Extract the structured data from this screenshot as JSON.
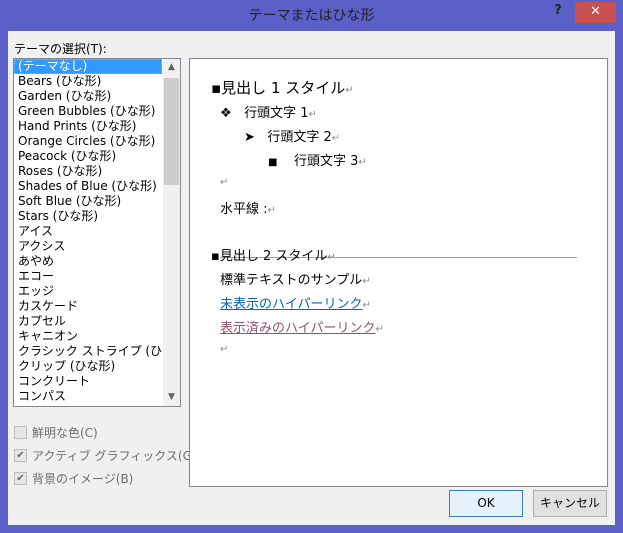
{
  "window": {
    "title": "テーマまたはひな形",
    "help": "?",
    "close": "✕"
  },
  "theme_label": "テーマの選択(T):",
  "themes": [
    "(テーマなし)",
    "Bears (ひな形)",
    "Garden (ひな形)",
    "Green Bubbles (ひな形)",
    "Hand Prints (ひな形)",
    "Orange Circles (ひな形)",
    "Peacock (ひな形)",
    "Roses (ひな形)",
    "Shades of Blue (ひな形)",
    "Soft Blue (ひな形)",
    "Stars (ひな形)",
    "アイス",
    "アクシス",
    "あやめ",
    "エコー",
    "エッジ",
    "カスケード",
    "カプセル",
    "キャニオン",
    "クラシック ストライプ (ひな形)",
    "クリップ (ひな形)",
    "コンクリート",
    "コンパス"
  ],
  "selected_theme": "(テーマなし)",
  "options": [
    {
      "label": "鮮明な色(C)",
      "checked": false
    },
    {
      "label": "アクティブ グラフィックス(G)",
      "checked": true
    },
    {
      "label": "背景のイメージ(B)",
      "checked": true
    }
  ],
  "preview": {
    "heading1": "見出し 1 スタイル",
    "bullet1": "行頭文字 1",
    "bullet2": "行頭文字 2",
    "bullet3": "行頭文字 3",
    "hr_label": "水平線 :",
    "heading2": "見出し 2 スタイル",
    "normal": "標準テキストのサンプル",
    "link": "未表示のハイパーリンク",
    "visited": "表示済みのハイパーリンク",
    "para_mark": "↵"
  },
  "buttons": {
    "ok": "OK",
    "cancel": "キャンセル"
  },
  "colors": {
    "titlebar": "#5b5fc7",
    "close": "#c75050",
    "selection": "#3399ff",
    "link": "#0563c1",
    "visited": "#954f72"
  }
}
